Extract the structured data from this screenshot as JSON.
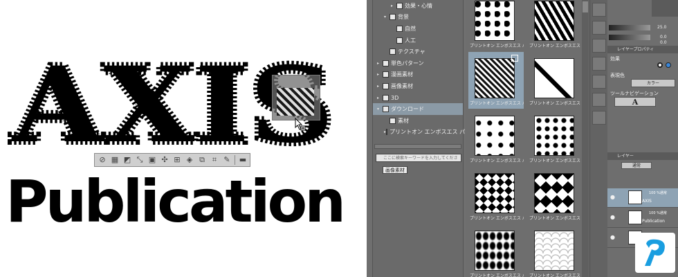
{
  "canvas": {
    "title_word": "AXIS",
    "subtitle_word": "Publication",
    "selection_toolbar_icons": [
      "deselect-icon",
      "select-all-icon",
      "invert-selection-icon",
      "shrink-selection-icon",
      "expand-selection-icon",
      "transform-icon",
      "scale-icon",
      "rotate-icon",
      "flip-icon",
      "crop-icon",
      "fill-icon",
      "erase-icon",
      "settings-icon"
    ]
  },
  "material_tree": {
    "items": [
      {
        "label": "効果・心情",
        "level": 2,
        "arrow": "▸"
      },
      {
        "label": "背景",
        "level": 1,
        "arrow": "▾"
      },
      {
        "label": "自然",
        "level": 2,
        "arrow": ""
      },
      {
        "label": "人工",
        "level": 2,
        "arrow": ""
      },
      {
        "label": "テクスチャ",
        "level": 1,
        "arrow": ""
      },
      {
        "label": "単色パターン",
        "level": 0,
        "arrow": "▸"
      },
      {
        "label": "漫画素材",
        "level": 0,
        "arrow": "▸"
      },
      {
        "label": "画像素材",
        "level": 0,
        "arrow": "▸"
      },
      {
        "label": "3D",
        "level": 0,
        "arrow": "▸"
      },
      {
        "label": "ダウンロード",
        "level": 0,
        "arrow": "▾",
        "selected": true
      },
      {
        "label": "素材",
        "level": 1,
        "arrow": ""
      },
      {
        "label": "プリントオン エンボスエス パ",
        "level": 1,
        "arrow": "▸"
      }
    ],
    "search_placeholder": "ここに検索キーワードを入力してください",
    "tag": "画像素材"
  },
  "thumbnails": {
    "caption": "プリントオン エンボスエス パター",
    "items": [
      {
        "pattern": "paws",
        "selected": false
      },
      {
        "pattern": "blobs",
        "selected": false
      },
      {
        "pattern": "waves",
        "selected": true
      },
      {
        "pattern": "feathers",
        "selected": false
      },
      {
        "pattern": "notes",
        "selected": false
      },
      {
        "pattern": "strawberries",
        "selected": false
      },
      {
        "pattern": "diamonds-small",
        "selected": false
      },
      {
        "pattern": "diamonds-large",
        "selected": false
      },
      {
        "pattern": "leaves",
        "selected": false
      },
      {
        "pattern": "scales",
        "selected": false
      }
    ]
  },
  "properties": {
    "value_a": "25.0",
    "value_b": "0.0",
    "value_c": "0.0",
    "header_layer_property": "レイヤープロパティ",
    "effect_label": "効果",
    "expression_color_label": "表現色",
    "color_button": "カラー",
    "tool_navigation_label": "ツールナビゲーション",
    "layer_tab": "レイヤー",
    "blend_mode": "通常",
    "layers": [
      {
        "name": "AXIS",
        "mode": "100 %通常",
        "selected": true
      },
      {
        "name": "Publication",
        "mode": "100 %通常",
        "selected": false
      },
      {
        "name": "",
        "mode": "",
        "selected": false
      }
    ]
  },
  "colors": {
    "app_bg": "#6f6f6f",
    "selection": "#8ea3b4",
    "logo": "#1a9ee0"
  }
}
